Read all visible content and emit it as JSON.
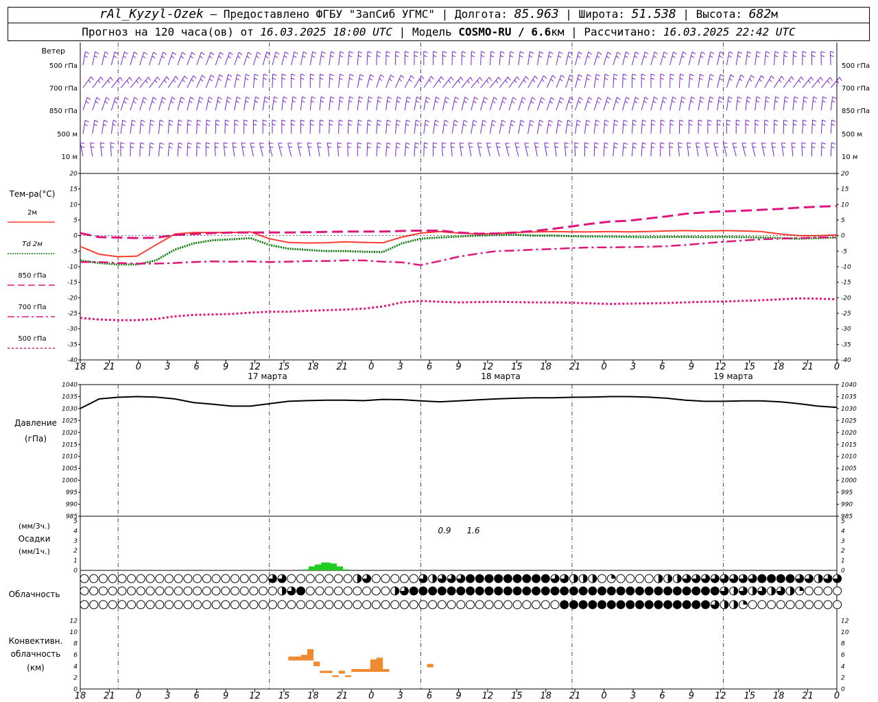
{
  "header": {
    "station": "rAl_Kyzyl-Ozek",
    "provider": "– Предоставлено ФГБУ \"ЗапСиб УГМС\"",
    "lon_label": "Долгота:",
    "lon": "85.963",
    "lat_label": "Широта:",
    "lat": "51.538",
    "alt_label": "Высота:",
    "alt": "682",
    "alt_unit": "м",
    "forecast_label": "Прогноз на 120 часа(ов) от",
    "forecast_from": "16.03.2025 18:00 UTC",
    "model_label": "Модель",
    "model": "COSMO-RU / 6.6",
    "model_unit": "км",
    "calc_label": "Рассчитано:",
    "calc_time": "16.03.2025 22:42 UTC"
  },
  "panels": {
    "wind": {
      "title": "Ветер",
      "levels": [
        "500 гПа",
        "700 гПа",
        "850 гПа",
        "500 м",
        "10  м"
      ],
      "color": "#7a1fd6"
    },
    "temperature": {
      "title": "Тем-ра(°С)",
      "legend": [
        "2м",
        "Td  2м",
        "850 гПа",
        "700 гПа",
        "500 гПа"
      ]
    },
    "pressure": {
      "title_1": "Давление",
      "title_2": "(гПа)"
    },
    "precip": {
      "title_1": "(мм/3ч.)",
      "title_2": "Осадки",
      "title_3": "(мм/1ч.)",
      "labels": [
        "0.9",
        "1.6"
      ]
    },
    "cloud": {
      "title": "Облачность"
    },
    "convective": {
      "title_1": "Конвективн.",
      "title_2": "облачность",
      "title_3": "(км)"
    }
  },
  "time_axis": {
    "hour_labels": [
      "18",
      "21",
      "0",
      "3",
      "6",
      "9",
      "12",
      "15",
      "18",
      "21",
      "0",
      "3",
      "6",
      "9",
      "12",
      "15",
      "18",
      "21",
      "0",
      "3",
      "6",
      "9",
      "12",
      "15",
      "18",
      "21",
      "0"
    ],
    "day_labels": [
      "17 марта",
      "18 марта",
      "19 марта"
    ]
  },
  "chart_data": [
    {
      "type": "line",
      "title": "Тем-ра(°С)",
      "ylim": [
        -40,
        20
      ],
      "yticks": [
        20,
        15,
        10,
        5,
        0,
        -5,
        -10,
        -15,
        -20,
        -25,
        -30,
        -35,
        -40
      ],
      "x_hours": [
        0,
        3,
        6,
        9,
        12,
        15,
        18,
        21,
        24,
        27,
        30,
        33,
        36,
        39,
        42,
        45,
        48,
        51,
        54,
        57,
        60,
        63,
        66,
        69,
        72,
        75,
        78,
        81,
        84,
        87,
        90,
        93,
        96,
        99,
        102,
        105,
        108,
        111,
        114,
        117,
        120
      ],
      "series": [
        {
          "name": "2м",
          "color": "#ff3b2f",
          "values": [
            -3.5,
            -6,
            -6.8,
            -6.6,
            -3,
            0.5,
            1,
            1,
            1,
            1.2,
            -1,
            -2.2,
            -2.4,
            -2.3,
            -2,
            -2.2,
            -2.3,
            -0.5,
            0.8,
            1.3,
            0.8,
            0.5,
            0.7,
            1,
            1.2,
            1.3,
            1.2,
            1.2,
            1.3,
            1.2,
            1.3,
            1.5,
            1.6,
            1.5,
            1.6,
            1.5,
            1.3,
            0.5,
            0,
            0,
            0.2
          ]
        },
        {
          "name": "Td  2м",
          "color": "#0a7d0a",
          "values": [
            -8,
            -8.8,
            -9.3,
            -9.3,
            -8,
            -4.5,
            -2.5,
            -1.5,
            -1.2,
            -0.8,
            -3,
            -4.2,
            -4.6,
            -5,
            -5,
            -5.2,
            -5.3,
            -2.5,
            -1,
            -0.6,
            -0.3,
            0,
            0.2,
            0.3,
            0,
            0,
            -0.2,
            -0.3,
            -0.3,
            -0.4,
            -0.5,
            -0.4,
            -0.4,
            -0.5,
            -0.4,
            -0.5,
            -0.6,
            -0.8,
            -1,
            -0.8,
            -0.6
          ]
        },
        {
          "name": "850 гПа",
          "color": "#e0147d",
          "values": [
            0.8,
            -0.5,
            -0.6,
            -0.8,
            -0.7,
            0.2,
            0.5,
            0.8,
            1,
            1,
            1,
            1,
            1.1,
            1.2,
            1.3,
            1.3,
            1.3,
            1.5,
            1.6,
            1.6,
            1,
            0.6,
            0.7,
            1,
            1.5,
            2.2,
            3,
            3.8,
            4.5,
            4.8,
            5.5,
            6.2,
            7,
            7.5,
            7.8,
            8,
            8.3,
            8.6,
            9,
            9.3,
            9.5
          ]
        },
        {
          "name": "700 гПа",
          "color": "#e0147d",
          "values": [
            -8.5,
            -8.5,
            -8.8,
            -9,
            -9,
            -8.8,
            -8.5,
            -8.3,
            -8.4,
            -8.3,
            -8.5,
            -8.4,
            -8.2,
            -8.2,
            -8,
            -8,
            -8.4,
            -8.6,
            -9.5,
            -8.2,
            -6.8,
            -5.8,
            -5,
            -4.8,
            -4.5,
            -4.3,
            -4,
            -3.8,
            -3.8,
            -3.7,
            -3.6,
            -3.4,
            -3,
            -2.5,
            -2,
            -1.6,
            -1.2,
            -1,
            -0.8,
            -0.6,
            -0.5
          ]
        },
        {
          "name": "500 гПа",
          "color": "#e0147d",
          "values": [
            -26.5,
            -27,
            -27.2,
            -27.2,
            -26.8,
            -26,
            -25.5,
            -25.4,
            -25.2,
            -24.8,
            -24.5,
            -24.5,
            -24.2,
            -24,
            -23.8,
            -23.5,
            -22.8,
            -21.5,
            -21,
            -21.3,
            -21.5,
            -21.4,
            -21.3,
            -21.4,
            -21.5,
            -21.5,
            -21.6,
            -21.8,
            -22,
            -21.9,
            -21.8,
            -21.7,
            -21.5,
            -21.3,
            -21.2,
            -21,
            -20.8,
            -20.5,
            -20.2,
            -20.3,
            -20.5
          ]
        }
      ]
    },
    {
      "type": "line",
      "title": "Давление",
      "ylim": [
        985,
        1040
      ],
      "yticks": [
        1040,
        1035,
        1030,
        1025,
        1020,
        1015,
        1010,
        1005,
        1000,
        995,
        990,
        985
      ],
      "x_hours": [
        0,
        3,
        6,
        9,
        12,
        15,
        18,
        21,
        24,
        27,
        30,
        33,
        36,
        39,
        42,
        45,
        48,
        51,
        54,
        57,
        60,
        63,
        66,
        69,
        72,
        75,
        78,
        81,
        84,
        87,
        90,
        93,
        96,
        99,
        102,
        105,
        108,
        111,
        114,
        117,
        120
      ],
      "series": [
        {
          "name": "Давление",
          "color": "#000000",
          "values": [
            1030,
            1034,
            1034.7,
            1035,
            1034.8,
            1034,
            1032.5,
            1031.8,
            1031,
            1031,
            1032,
            1033,
            1033.3,
            1033.5,
            1033.5,
            1033.3,
            1033.8,
            1033.7,
            1033.2,
            1032.8,
            1033.2,
            1033.6,
            1034,
            1034.3,
            1034.5,
            1034.5,
            1034.7,
            1034.8,
            1035,
            1035,
            1034.8,
            1034.3,
            1033.5,
            1033,
            1033,
            1033.2,
            1033.2,
            1032.8,
            1032,
            1031,
            1030.5
          ]
        }
      ]
    },
    {
      "type": "bar",
      "title": "Осадки",
      "ylim": [
        0,
        5
      ],
      "yticks": [
        5,
        4,
        3,
        2,
        1,
        0
      ],
      "x_hours": [
        36,
        37,
        38,
        39,
        40,
        41,
        42
      ],
      "series": [
        {
          "name": "мм/1ч.",
          "color": "#22cc22",
          "values": [
            0.1,
            0.4,
            0.6,
            0.8,
            0.7,
            0.4,
            0.1
          ]
        }
      ]
    },
    {
      "type": "bar",
      "title": "Конвективн. облачность",
      "ylim": [
        0,
        13
      ],
      "yticks": [
        12,
        10,
        8,
        6,
        4,
        2,
        0
      ],
      "segments": [
        {
          "x0": 33,
          "x1": 35,
          "bottom": 5,
          "top": 5.7
        },
        {
          "x0": 35,
          "x1": 36,
          "bottom": 5,
          "top": 6
        },
        {
          "x0": 36,
          "x1": 37,
          "bottom": 5,
          "top": 7
        },
        {
          "x0": 37,
          "x1": 38,
          "bottom": 4,
          "top": 4.8
        },
        {
          "x0": 38,
          "x1": 40,
          "bottom": 2.8,
          "top": 3.2
        },
        {
          "x0": 40,
          "x1": 41,
          "bottom": 2.1,
          "top": 2.4
        },
        {
          "x0": 41,
          "x1": 42,
          "bottom": 2.7,
          "top": 3.2
        },
        {
          "x0": 42,
          "x1": 43,
          "bottom": 2.1,
          "top": 2.4
        },
        {
          "x0": 43,
          "x1": 46,
          "bottom": 3,
          "top": 3.5
        },
        {
          "x0": 46,
          "x1": 47,
          "bottom": 3,
          "top": 5.2
        },
        {
          "x0": 47,
          "x1": 48,
          "bottom": 3,
          "top": 5.5
        },
        {
          "x0": 48,
          "x1": 49,
          "bottom": 3,
          "top": 3.5
        },
        {
          "x0": 55,
          "x1": 56,
          "bottom": 3.8,
          "top": 4.4
        }
      ],
      "color": "#f08a30"
    }
  ],
  "cloud_rows": [
    "0000000000000000000033000000023000003233344444444433222010000222333333334444332332321023231000001000100000000000000000000",
    "0000000000000000000002340000000002344444444444444444444444444444444432323232100000000000000000000000000000000000000000",
    "0000000000000000000000000000000000000000000000000004444444444444444322100000000000000000000000000000000000000000000000000"
  ]
}
